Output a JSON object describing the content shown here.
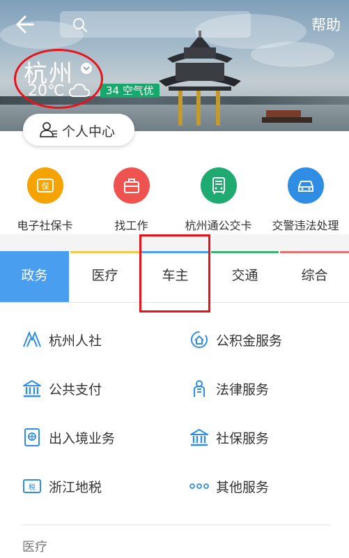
{
  "header": {
    "search_placeholder": "",
    "help_label": "帮助",
    "city": "杭州",
    "temperature": "20℃",
    "weather_icon": "cloud-icon",
    "aqi_label": "34 空气优",
    "personal_center_label": "个人中心"
  },
  "quick_services": [
    {
      "label": "电子社保卡",
      "icon": "social-security-card-icon",
      "color": "#f4a300"
    },
    {
      "label": "找工作",
      "icon": "briefcase-icon",
      "color": "#ef5350"
    },
    {
      "label": "杭州通公交卡",
      "icon": "bus-card-icon",
      "color": "#1faa72"
    },
    {
      "label": "交警违法处理",
      "icon": "car-icon",
      "color": "#2f8de4"
    }
  ],
  "tabs": [
    {
      "label": "政务",
      "active": true,
      "bar_color": "#4a9ef0"
    },
    {
      "label": "医疗",
      "active": false,
      "bar_color": "#f2c94c"
    },
    {
      "label": "车主",
      "active": false,
      "bar_color": "#4a9ef0"
    },
    {
      "label": "交通",
      "active": false,
      "bar_color": "#3cb371"
    },
    {
      "label": "综合",
      "active": false,
      "bar_color": "#e57373"
    }
  ],
  "services": [
    {
      "label": "杭州人社",
      "icon": "hr-social-icon"
    },
    {
      "label": "公积金服务",
      "icon": "housing-fund-icon"
    },
    {
      "label": "公共支付",
      "icon": "public-payment-icon"
    },
    {
      "label": "法律服务",
      "icon": "legal-service-icon"
    },
    {
      "label": "出入境业务",
      "icon": "passport-icon"
    },
    {
      "label": "社保服务",
      "icon": "social-insurance-icon"
    },
    {
      "label": "浙江地税",
      "icon": "tax-icon"
    },
    {
      "label": "其他服务",
      "icon": "more-dots-icon"
    }
  ],
  "next_section_title": "医疗",
  "colors": {
    "accent": "#4a9ef0",
    "icon_blue": "#2f8de4",
    "annotation_red": "#e8121b",
    "aqi_green": "#18a86b"
  }
}
